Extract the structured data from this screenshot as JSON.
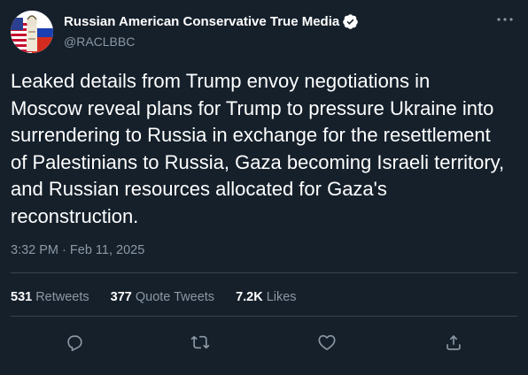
{
  "author": {
    "display_name": "Russian American Conservative True Media",
    "handle": "@RACLBBC",
    "verified": true
  },
  "tweet": {
    "text": "Leaked details from Trump envoy negotiations in\nMoscow reveal plans for Trump to pressure Ukraine into\nsurrendering to Russia in exchange for the resettlement\nof Palestinians to Russia, Gaza becoming Israeli territory,\nand Russian resources allocated for Gaza's\nreconstruction.",
    "time": "3:32 PM",
    "separator": "·",
    "date": "Feb 11, 2025"
  },
  "stats": {
    "retweets_count": "531",
    "retweets_label": "Retweets",
    "quotes_count": "377",
    "quotes_label": "Quote Tweets",
    "likes_count": "7.2K",
    "likes_label": "Likes"
  },
  "icons": {
    "more": "more-horizontal-icon",
    "verified": "verified-badge-icon",
    "reply": "reply-icon",
    "retweet": "retweet-icon",
    "like": "heart-icon",
    "share": "share-icon"
  },
  "colors": {
    "background": "#15202b",
    "text_primary": "#ffffff",
    "text_secondary": "#8b98a5",
    "divider": "#38444d",
    "icon": "#8b98a5"
  }
}
